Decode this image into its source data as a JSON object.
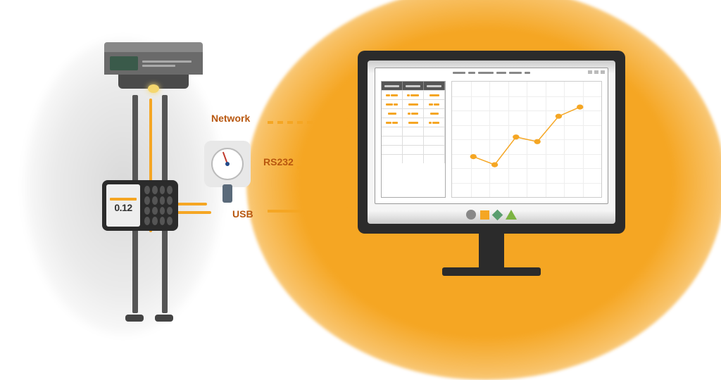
{
  "connections": {
    "network": "Network",
    "rs232": "RS232",
    "usb": "USB"
  },
  "reader": {
    "display_value": "0.12"
  },
  "chart_data": {
    "type": "line",
    "x": [
      1,
      2,
      3,
      4,
      5,
      6
    ],
    "values": [
      35,
      28,
      52,
      48,
      70,
      78
    ],
    "xlim": [
      0,
      7
    ],
    "ylim": [
      0,
      100
    ],
    "grid": true,
    "marker_color": "#f5a623",
    "line_color": "#f5a623"
  },
  "shapes": {
    "circle": "circle-glyph",
    "square": "square-glyph",
    "diamond": "diamond-glyph",
    "triangle": "triangle-glyph"
  }
}
